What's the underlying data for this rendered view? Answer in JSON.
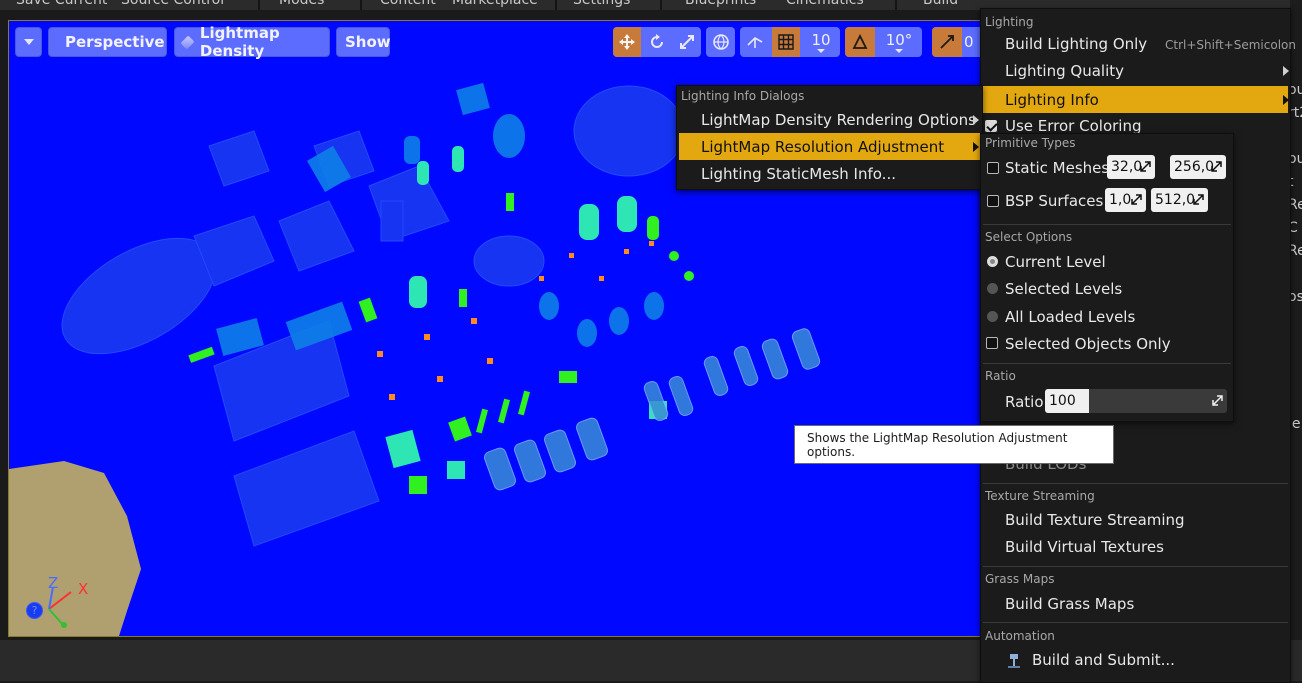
{
  "editor_toolbar": {
    "items": [
      "Save Current",
      "Source Control",
      "Modes",
      "Content",
      "Marketplace",
      "Settings",
      "Blueprints",
      "Cinematics",
      "Build"
    ]
  },
  "viewport": {
    "options_caret": "▼",
    "perspective_label": "Perspective",
    "view_mode_label": "Lightmap Density",
    "show_label": "Show",
    "grid_snap_value": "10",
    "rotation_snap_value": "10°",
    "scale_snap_value": "0",
    "axis_x_label": "X",
    "axis_z_label": "Z",
    "help_glyph": "?",
    "colors": {
      "background": "#0008ff",
      "floor": "#b0a070",
      "axis_x": "#ff3030",
      "axis_y": "#30c030",
      "axis_z": "#4a6cff"
    }
  },
  "side_panel_fragments": [
    "ou",
    "rt2",
    "ou",
    "t",
    "Re",
    "C",
    "Re",
    "os",
    "je"
  ],
  "build_menu": {
    "sections": {
      "lighting": "Lighting",
      "texture_streaming": "Texture Streaming",
      "grass_maps": "Grass Maps",
      "automation": "Automation"
    },
    "items": {
      "build_lighting_only": "Build Lighting Only",
      "build_lighting_only_shortcut": "Ctrl+Shift+Semicolon",
      "lighting_quality": "Lighting Quality",
      "lighting_info": "Lighting Info",
      "use_error_coloring": "Use Error Coloring",
      "build_lods_partial": "Build LODs",
      "build_texture_streaming": "Build Texture Streaming",
      "build_virtual_textures": "Build Virtual Textures",
      "build_grass_maps": "Build Grass Maps",
      "build_and_submit": "Build and Submit..."
    }
  },
  "lighting_info_menu": {
    "header": "Lighting Info Dialogs",
    "items": [
      "LightMap Density Rendering Options",
      "LightMap Resolution Adjustment",
      "Lighting StaticMesh Info..."
    ]
  },
  "resolution_adjustment": {
    "primitive_types_header": "Primitive Types",
    "static_meshes_label": "Static Meshes",
    "static_meshes_min": "32,0",
    "static_meshes_max": "256,0",
    "bsp_surfaces_label": "BSP Surfaces",
    "bsp_min": "1,0",
    "bsp_max": "512,0",
    "select_options_header": "Select Options",
    "current_level": "Current Level",
    "selected_levels": "Selected Levels",
    "all_loaded_levels": "All Loaded Levels",
    "selected_objects_only": "Selected Objects Only",
    "ratio_header": "Ratio",
    "ratio_label": "Ratio",
    "ratio_value": "100"
  },
  "tooltip": {
    "text": "Shows the LightMap Resolution Adjustment options."
  }
}
